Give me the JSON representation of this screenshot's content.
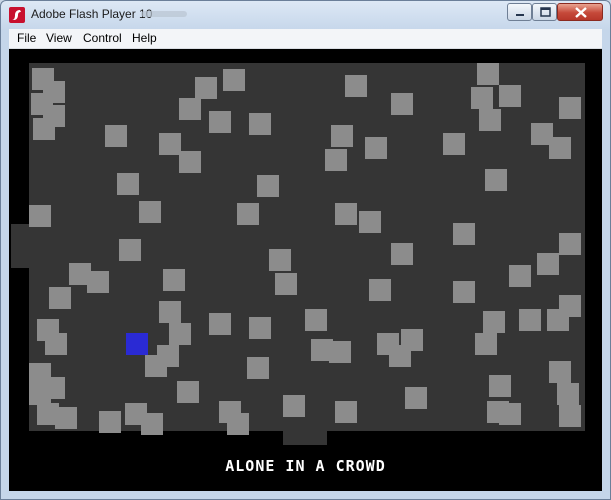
{
  "window": {
    "title": "Adobe Flash Player 10",
    "icon": "flash-player-icon"
  },
  "menu": {
    "items": [
      "File",
      "View",
      "Control",
      "Help"
    ]
  },
  "game": {
    "caption": "ALONE IN A CROWD",
    "colors": {
      "stage": "#353535",
      "crate": "#8c8c8c",
      "player": "#2a2ad4",
      "border": "#000000"
    }
  }
}
